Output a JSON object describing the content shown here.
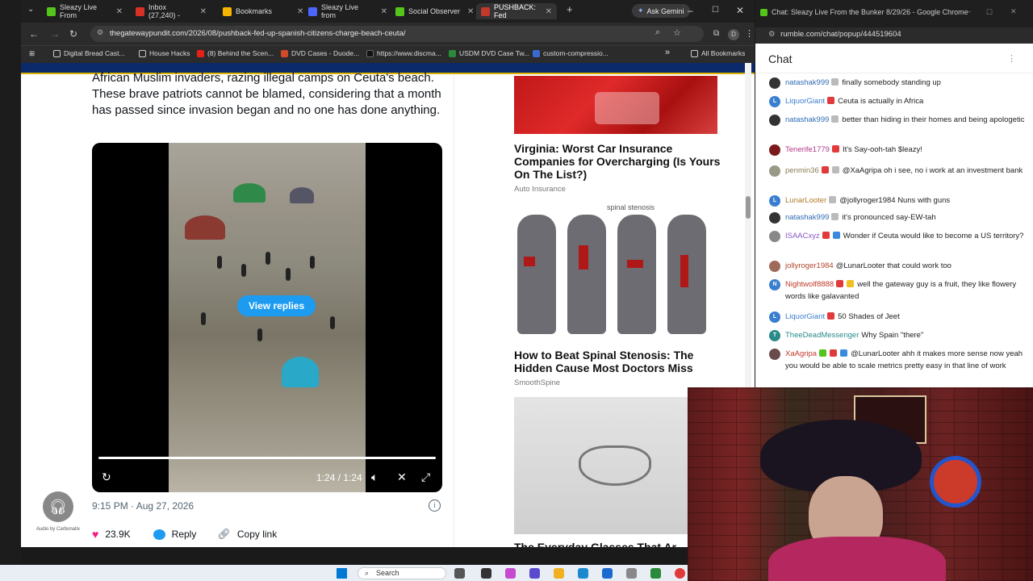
{
  "browser": {
    "tabs": [
      {
        "label": "Sleazy Live From",
        "color": "#53c51b",
        "active": false
      },
      {
        "label": "Inbox (27,240) -",
        "color": "#d93025",
        "active": false
      },
      {
        "label": "Bookmarks",
        "color": "#f6b500",
        "active": false
      },
      {
        "label": "Sleazy Live from",
        "color": "#4a66ff",
        "active": false
      },
      {
        "label": "Social Observer",
        "color": "#53c51b",
        "active": false
      },
      {
        "label": "PUSHBACK: Fed",
        "color": "#c0392b",
        "active": true
      }
    ],
    "new_tab": "+",
    "ask_gemini": "Ask Gemini",
    "url": "thegatewaypundit.com/2026/08/pushback-fed-up-spanish-citizens-charge-beach-ceuta/",
    "profile_initial": "D",
    "bookmarks": [
      "Digital Bread Cast...",
      "House Hacks",
      "(8) Behind the Scen...",
      "DVD Cases - Duode...",
      "https://www.discma...",
      "USDM DVD Case Tw...",
      "custom-compressio..."
    ],
    "bookmarks_more": "»",
    "all_bookmarks": "All Bookmarks"
  },
  "tweet": {
    "text": "African Muslim invaders, razing illegal camps on Ceuta's beach. These brave patriots cannot be blamed, considering that a month has passed since invasion began and no one has done anything.",
    "view_replies": "View replies",
    "video_time": "1:24 / 1:24",
    "video_progress": 1.0,
    "timestamp": "9:15 PM · Aug 27, 2026",
    "likes": "23.9K",
    "reply_label": "Reply",
    "copy_link_label": "Copy link"
  },
  "audio_widget": {
    "label": "Audio by Carbonatix"
  },
  "ads": [
    {
      "title": "Virginia: Worst Car Insurance Companies for Overcharging (Is Yours On The List?)",
      "source": "Auto Insurance"
    },
    {
      "image_caption": "spinal stenosis",
      "title": "How to Beat Spinal Stenosis: The Hidden Cause Most Doctors Miss",
      "source": "SmoothSpine"
    },
    {
      "title": "The Everyday Glasses That Ar..."
    }
  ],
  "chat_window": {
    "title": "Chat: Sleazy Live From the Bunker 8/29/26 - Google Chrome",
    "url": "rumble.com/chat/popup/444519604",
    "header": "Chat",
    "messages": [
      {
        "user": "natashak999",
        "color": "#2f6bb3",
        "text": "finally somebody standing up"
      },
      {
        "user": "LiquorGiant",
        "color": "#3a7ed0",
        "text": "Ceuta is actually in Africa"
      },
      {
        "user": "natashak999",
        "color": "#2f6bb3",
        "text": "better than hiding in their homes and being apologetic"
      },
      {
        "user": "Tenerife1779",
        "color": "#b23a86",
        "text": "It's Say-ooh-tah $leazy!"
      },
      {
        "user": "penmin36",
        "color": "#8a7a50",
        "text": "@XaAgripa oh i see, no i work at an investment bank"
      },
      {
        "user": "LunarLooter",
        "color": "#b07a2a",
        "text": "@jollyroger1984 Nuns with guns"
      },
      {
        "user": "natashak999",
        "color": "#2f6bb3",
        "text": "it's pronounced say-EW-tah"
      },
      {
        "user": "ISAACxyz",
        "color": "#8a55c2",
        "text": "Wonder if Ceuta would like to become a US territory?"
      },
      {
        "user": "jollyroger1984",
        "color": "#b0452d",
        "text": "@LunarLooter that could work too"
      },
      {
        "user": "Nightwolf8888",
        "color": "#c0392b",
        "text": "well the gateway guy is a fruit, they like flowery words like galavanted"
      },
      {
        "user": "LiquorGiant",
        "color": "#3a7ed0",
        "text": "50 Shades of Jeet"
      },
      {
        "user": "TheeDeadMessenger",
        "color": "#2a8a8a",
        "text": "Why Spain \"there\""
      },
      {
        "user": "XaAgripa",
        "color": "#c0392b",
        "text": "@LunarLooter ahh it makes more sense now yeah you would be able to scale metrics pretty easy in that line of work"
      }
    ]
  },
  "taskbar": {
    "search_label": "Search"
  }
}
